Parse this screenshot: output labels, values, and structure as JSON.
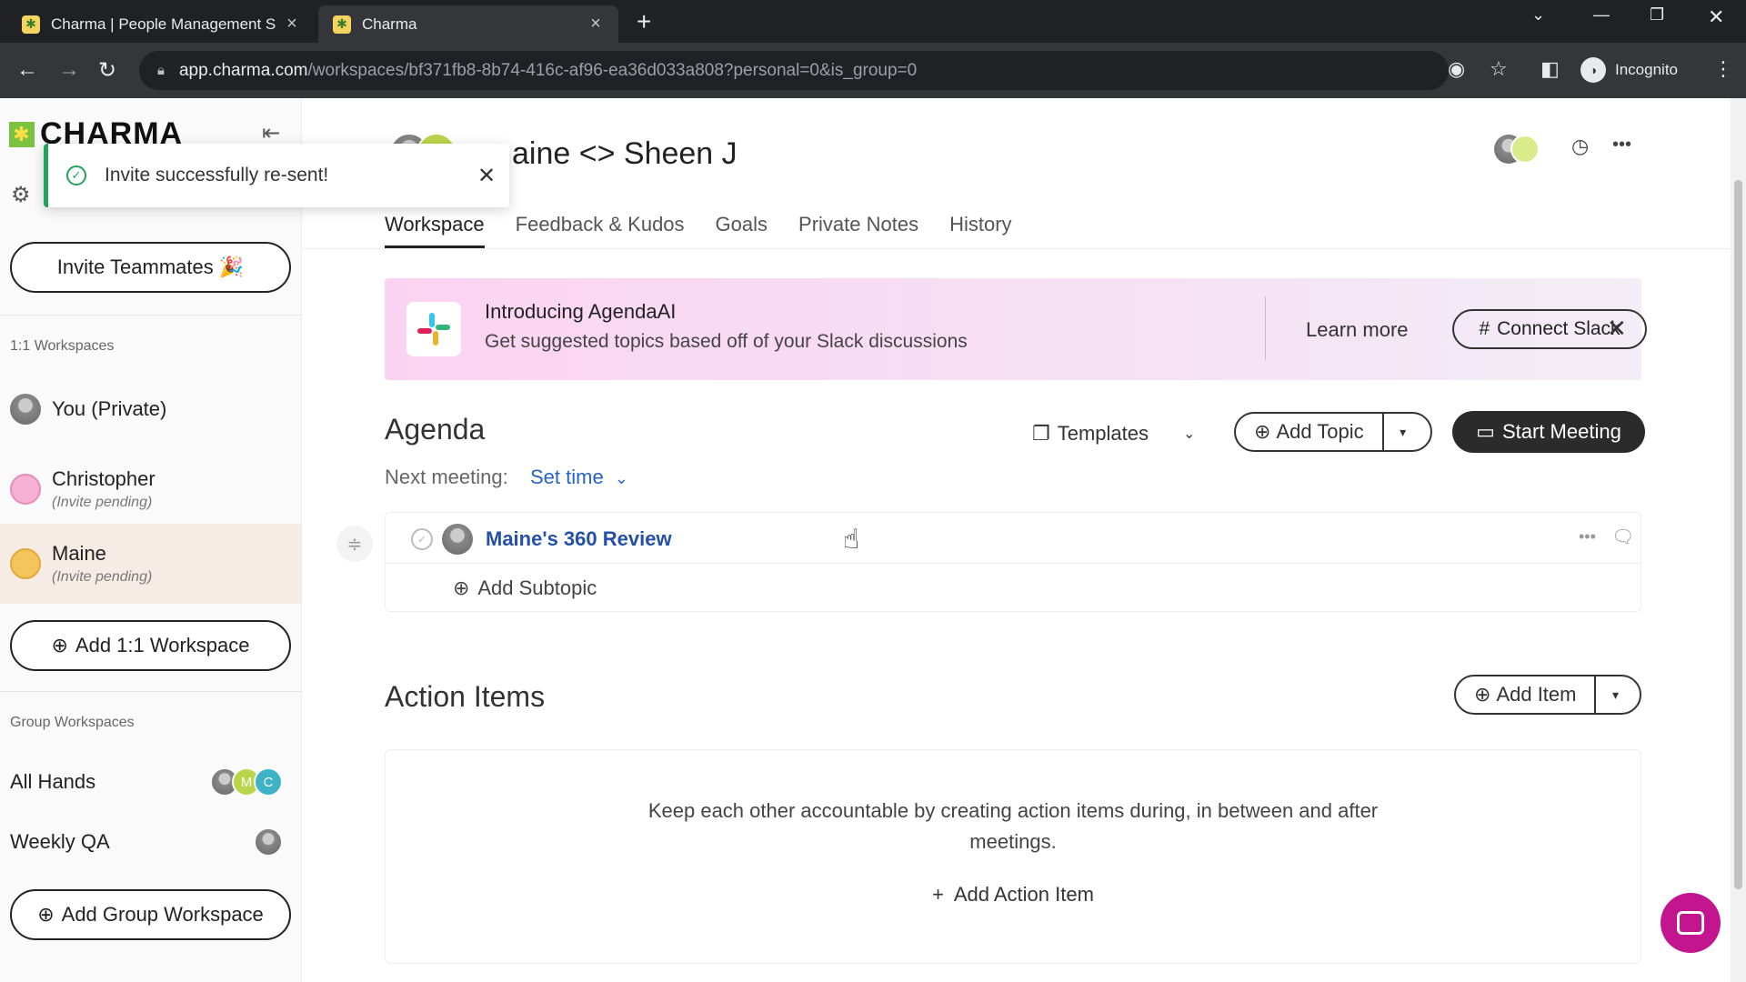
{
  "browser": {
    "tabs": [
      {
        "title": "Charma | People Management S",
        "active": false
      },
      {
        "title": "Charma",
        "active": true
      }
    ],
    "url_host": "app.charma.com",
    "url_path": "/workspaces/bf371fb8-8b74-416c-af96-ea36d033a808?personal=0&is_group=0",
    "profile_label": "Incognito"
  },
  "sidebar": {
    "logo_text": "CHARMA",
    "invite_button": "Invite Teammates 🎉",
    "one_on_one_heading": "1:1 Workspaces",
    "workspaces": [
      {
        "name": "You (Private)",
        "sub": ""
      },
      {
        "name": "Christopher",
        "sub": "(Invite pending)"
      },
      {
        "name": "Maine",
        "sub": "(Invite pending)"
      }
    ],
    "add_workspace_button": "Add 1:1 Workspace",
    "group_heading": "Group Workspaces",
    "groups": [
      {
        "name": "All Hands",
        "initials": [
          "",
          "M",
          "C"
        ]
      },
      {
        "name": "Weekly QA",
        "initials": [
          ""
        ]
      }
    ],
    "add_group_button": "Add Group Workspace"
  },
  "toast": {
    "message": "Invite successfully re-sent!"
  },
  "header": {
    "title": "aine <> Sheen J",
    "tabs": [
      "Workspace",
      "Feedback & Kudos",
      "Goals",
      "Private Notes",
      "History"
    ],
    "active_tab": "Workspace"
  },
  "banner": {
    "heading": "Introducing AgendaAI",
    "subtext": "Get suggested topics based off of your Slack discussions",
    "learn_more": "Learn more",
    "connect_button": "Connect Slack"
  },
  "agenda": {
    "title": "Agenda",
    "templates_label": "Templates",
    "add_topic_label": "Add Topic",
    "start_meeting_label": "Start Meeting",
    "next_meeting_label": "Next meeting:",
    "set_time_label": "Set time",
    "topics": [
      {
        "title": "Maine's 360 Review"
      }
    ],
    "add_subtopic_label": "Add Subtopic"
  },
  "action_items": {
    "title": "Action Items",
    "add_item_label": "Add Item",
    "empty_text": "Keep each other accountable by creating action items during, in between and after meetings.",
    "add_action_label": "Add Action Item"
  },
  "colors": {
    "link_blue": "#2450a8",
    "set_time_blue": "#2563c9",
    "success_green": "#22a35a",
    "chat_magenta": "#c3158d",
    "selected_row": "#f7ebe6"
  }
}
